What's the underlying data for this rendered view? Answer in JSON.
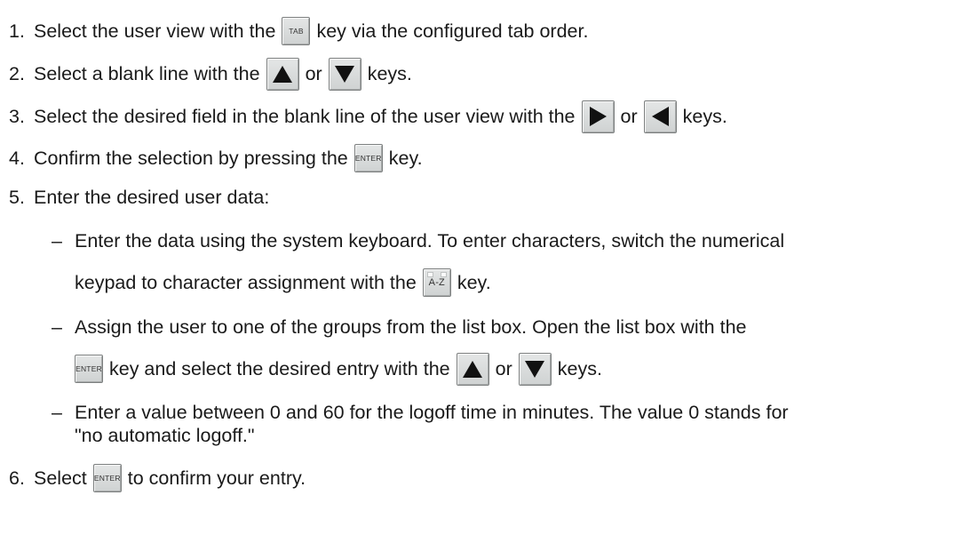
{
  "steps": [
    {
      "num": "1.",
      "a": "Select the user view with the",
      "key": "TAB",
      "b": "key via the configured tab order."
    },
    {
      "num": "2.",
      "a": "Select a blank line with the",
      "or": "or",
      "b": "keys."
    },
    {
      "num": "3.",
      "a": "Select the desired field in the blank line of the user view with the",
      "or": "or",
      "b": "keys."
    },
    {
      "num": "4.",
      "a": "Confirm the selection by pressing the",
      "key": "ENTER",
      "b": "key."
    },
    {
      "num": "5.",
      "a": "Enter the desired user data:"
    },
    {
      "num": "6.",
      "a": "Select",
      "key": "ENTER",
      "b": "to confirm your entry."
    }
  ],
  "substeps": [
    {
      "dash": "–",
      "line1": "Enter the data using the system keyboard. To enter characters, switch the numerical",
      "line2a": "keypad to character assignment with the",
      "key": "A-Z",
      "line2b": "key."
    },
    {
      "dash": "–",
      "line1": "Assign the user to one of the groups from the list box. Open the list box with the",
      "key": "ENTER",
      "line2a": "key and select the desired entry with the",
      "or": "or",
      "line2b": "keys."
    },
    {
      "dash": "–",
      "line1": "Enter a value between 0 and 60 for the logoff time in minutes. The value 0 stands for",
      "line2": "\"no automatic logoff.\""
    }
  ],
  "icons": [
    "arrow-up-key",
    "arrow-down-key",
    "arrow-right-key",
    "arrow-left-key"
  ]
}
